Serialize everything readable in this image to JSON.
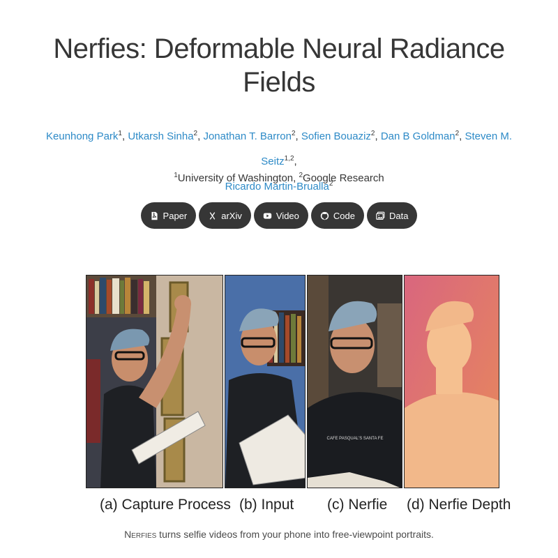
{
  "title": {
    "line1": "Nerfies: Deformable Neural Radiance",
    "line2": "Fields"
  },
  "authors": [
    {
      "name": "Keunhong Park",
      "sup": "1"
    },
    {
      "name": "Utkarsh Sinha",
      "sup": "2"
    },
    {
      "name": "Jonathan T. Barron",
      "sup": "2"
    },
    {
      "name": "Sofien Bouaziz",
      "sup": "2"
    },
    {
      "name": "Dan B Goldman",
      "sup": "2"
    },
    {
      "name": "Steven M. Seitz",
      "sup": "1,2"
    },
    {
      "name": "Ricardo Martin-Brualla",
      "sup": "2"
    }
  ],
  "affiliations": {
    "sup1": "1",
    "aff1": "University of Washington, ",
    "sup2": "2",
    "aff2": "Google Research"
  },
  "buttons": [
    {
      "label": "Paper",
      "icon": "pdf-icon"
    },
    {
      "label": "arXiv",
      "icon": "arxiv-icon"
    },
    {
      "label": "Video",
      "icon": "youtube-icon"
    },
    {
      "label": "Code",
      "icon": "github-icon"
    },
    {
      "label": "Data",
      "icon": "images-icon"
    }
  ],
  "teaser": {
    "captions": [
      "(a) Capture Process",
      "(b) Input",
      "(c) Nerfie",
      "(d) Nerfie Depth"
    ],
    "shirt_text": "CAFE PASQUAL'S SANTA FE"
  },
  "subtitle": {
    "name": "Nerfies",
    "text": " turns selfie videos from your phone into free-viewpoint portraits."
  },
  "colors": {
    "link": "#2d8ac7",
    "button_bg": "#363636",
    "depth_bg": "#d9607a",
    "depth_fg": "#f2b88a"
  }
}
